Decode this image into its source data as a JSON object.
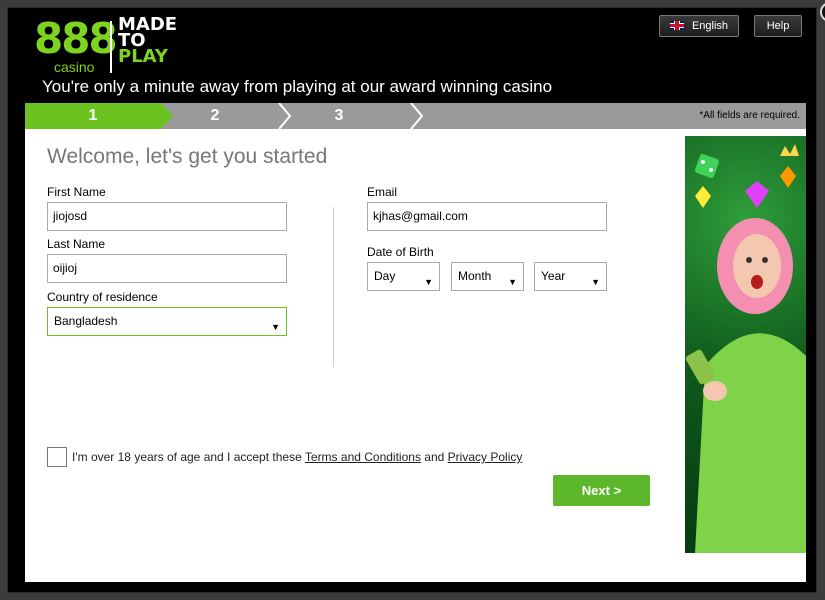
{
  "header": {
    "logo_number": "888",
    "logo_sub": "casino",
    "logo_tag_line1": "MADE",
    "logo_tag_line2": "TO",
    "logo_tag_line3": "PLAY",
    "tagline": "You're only a minute away from playing at our award winning casino",
    "language_label": "English",
    "help_label": "Help",
    "close_glyph": "×"
  },
  "steps": {
    "items": [
      "1",
      "2",
      "3"
    ],
    "active": 1,
    "required_note": "*All fields are required."
  },
  "form": {
    "welcome": "Welcome, let's get you started",
    "first_name_label": "First Name",
    "first_name_value": "jiojosd",
    "last_name_label": "Last Name",
    "last_name_value": "oijioj",
    "country_label": "Country of residence",
    "country_value": "Bangladesh",
    "email_label": "Email",
    "email_value": "kjhas@gmail.com",
    "dob_label": "Date of Birth",
    "dob_day": "Day",
    "dob_month": "Month",
    "dob_year": "Year",
    "terms_prefix": "I'm over 18 years of age and I accept these",
    "terms_link": "Terms and Conditions",
    "terms_and": "and",
    "privacy_link": "Privacy Policy",
    "next_label": "Next >"
  },
  "colors": {
    "brand_green": "#7ed321",
    "step_active": "#6cc21f",
    "button_green": "#5cb82a",
    "step_bar": "#9a9a9a"
  },
  "icons": {
    "flag": "uk-flag-icon",
    "close": "close-icon",
    "dropdown": "chevron-down-icon"
  }
}
